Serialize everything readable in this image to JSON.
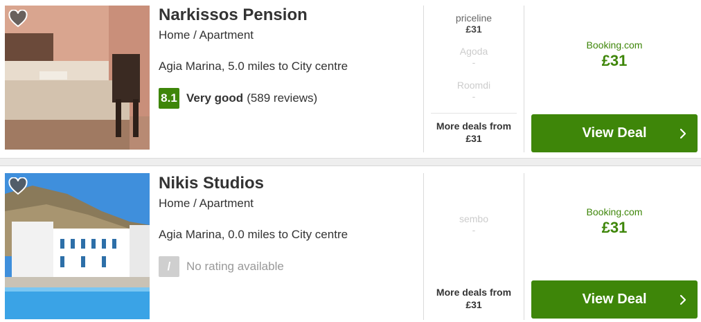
{
  "colors": {
    "brand_green": "#3e8609",
    "text": "#333333",
    "muted": "#999999",
    "faint": "#cccccc"
  },
  "listings": [
    {
      "name": "Narkissos Pension",
      "type": "Home / Apartment",
      "location": "Agia Marina, 5.0 miles to City centre",
      "rating": {
        "score": "8.1",
        "label": "Very good",
        "reviews": "(589 reviews)"
      },
      "other_prices": [
        {
          "provider": "priceline",
          "price": "£31"
        },
        {
          "provider": "Agoda",
          "price": "-"
        },
        {
          "provider": "Roomdi",
          "price": "-"
        }
      ],
      "more_deals_label": "More deals from",
      "more_deals_price": "£31",
      "best_provider": "Booking.com",
      "best_price": "£31",
      "button_label": "View Deal",
      "icons": {
        "favorite": "heart-icon",
        "arrow": "chevron-right-icon"
      }
    },
    {
      "name": "Nikis Studios",
      "type": "Home / Apartment",
      "location": "Agia Marina, 0.0 miles to City centre",
      "rating": {
        "score": "/",
        "no_rating_text": "No rating available"
      },
      "other_prices": [
        {
          "provider": "sembo",
          "price": "-"
        }
      ],
      "more_deals_label": "More deals from",
      "more_deals_price": "£31",
      "best_provider": "Booking.com",
      "best_price": "£31",
      "button_label": "View Deal",
      "icons": {
        "favorite": "heart-icon",
        "arrow": "chevron-right-icon"
      }
    }
  ]
}
